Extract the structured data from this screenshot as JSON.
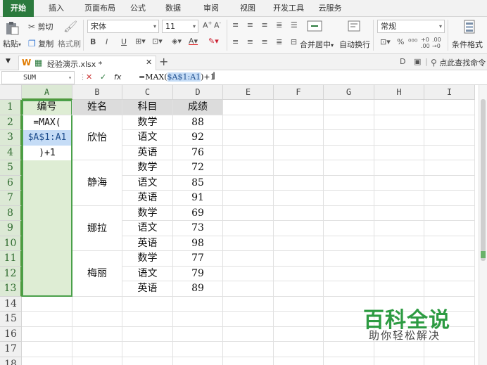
{
  "ribbon": {
    "tabs": [
      "开始",
      "插入",
      "页面布局",
      "公式",
      "数据",
      "审阅",
      "视图",
      "开发工具",
      "云服务"
    ]
  },
  "toolbar": {
    "paste": "粘贴",
    "cut": "剪切",
    "copy": "复制",
    "format_painter": "格式刷",
    "font_name": "宋体",
    "font_size": "11",
    "bold": "B",
    "italic": "I",
    "underline": "U",
    "merge_center": "合并居中",
    "wrap_text": "自动换行",
    "number_format": "常规",
    "percent": "%",
    "conditional_format": "条件格式",
    "search_label": "点此查找命令"
  },
  "document": {
    "file_name": "经验演示.xlsx *"
  },
  "formula_bar": {
    "name_box": "SUM",
    "fx": "fx",
    "cancel": "✕",
    "confirm": "✓",
    "formula_prefix": "=MAX(",
    "formula_ref": "$A$1:A1",
    "formula_suffix": ")+1"
  },
  "sheet": {
    "columns": [
      "A",
      "B",
      "C",
      "D",
      "E",
      "F",
      "G",
      "H",
      "I"
    ],
    "rows": [
      "1",
      "2",
      "3",
      "4",
      "5",
      "6",
      "7",
      "8",
      "9",
      "10",
      "11",
      "12",
      "13",
      "14",
      "15",
      "16",
      "17",
      "18"
    ],
    "headers": {
      "a": "编号",
      "b": "姓名",
      "c": "科目",
      "d": "成绩"
    },
    "edit_cell": {
      "line1": "=MAX(",
      "line2": "$A$1:A1",
      "line3": ")+1"
    },
    "names": [
      "欣怡",
      "静海",
      "娜拉",
      "梅丽"
    ],
    "subjects": [
      "数学",
      "语文",
      "英语",
      "数学",
      "语文",
      "英语",
      "数学",
      "语文",
      "英语",
      "数学",
      "语文",
      "英语"
    ],
    "scores": [
      "88",
      "92",
      "76",
      "72",
      "85",
      "91",
      "69",
      "73",
      "98",
      "77",
      "79",
      "89"
    ]
  },
  "watermark": {
    "title": "百科全说",
    "subtitle": "助你轻松解决"
  },
  "colors": {
    "accent": "#2b7a3d",
    "selection": "#4aa04a",
    "header_fill": "#dcdcdc"
  }
}
